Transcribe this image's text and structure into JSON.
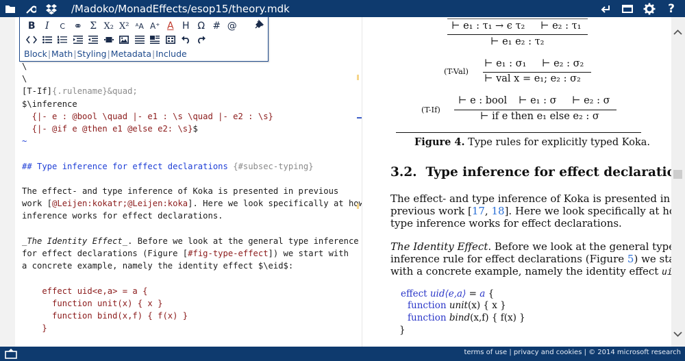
{
  "topbar": {
    "file_path": "/Madoko/MonadEffects/esop15/theory.mdk",
    "icons": [
      "folder-icon",
      "wrench-icon",
      "dropbox-icon",
      "return-icon",
      "window-icon",
      "gear-icon",
      "help-icon"
    ],
    "help_label": "?"
  },
  "toolbar": {
    "row1": [
      "B",
      "I",
      "C",
      "⚭",
      "Σ",
      "X₂",
      "X²",
      "ᴬA",
      "A⁺",
      "A",
      "H",
      "Ω",
      "#",
      "@"
    ],
    "row2_icons": [
      "code-icon",
      "bullet-list-icon",
      "numbered-list-icon",
      "indent-icon",
      "outdent-icon",
      "figure-icon",
      "image-icon",
      "align-icon",
      "caption-icon",
      "table-icon",
      "undo-icon",
      "redo-icon"
    ],
    "tabs": [
      "Block",
      "Math",
      "Styling",
      "Metadata",
      "Include"
    ]
  },
  "editor": {
    "lines": [
      {
        "parts": [
          {
            "t": "\\",
            "c": "dark"
          }
        ]
      },
      {
        "parts": [
          {
            "t": "\\",
            "c": "dark"
          }
        ]
      },
      {
        "parts": [
          {
            "t": "[T-If]",
            "c": "dark"
          },
          {
            "t": "{.rulename}&quad;",
            "c": "gray"
          }
        ]
      },
      {
        "parts": [
          {
            "t": "$\\inference",
            "c": "dark"
          }
        ]
      },
      {
        "parts": [
          {
            "t": "  {|- e : @bool \\quad |- e1 : \\s \\quad |- e2 : \\s}",
            "c": "red"
          }
        ]
      },
      {
        "parts": [
          {
            "t": "  {|- @if e @then e1 @else e2: \\s}",
            "c": "red"
          },
          {
            "t": "$",
            "c": "dark"
          }
        ]
      },
      {
        "parts": [
          {
            "t": "~",
            "c": "blue"
          }
        ]
      },
      {
        "parts": [
          {
            "t": "",
            "c": "dark"
          }
        ]
      },
      {
        "parts": [
          {
            "t": "## Type inference for effect declarations ",
            "c": "blue"
          },
          {
            "t": "{#subsec-typing}",
            "c": "gray"
          }
        ]
      },
      {
        "parts": [
          {
            "t": "",
            "c": "dark"
          }
        ]
      },
      {
        "parts": [
          {
            "t": "The effect- and type inference of Koka is presented in previous",
            "c": "dark"
          }
        ]
      },
      {
        "parts": [
          {
            "t": "work [",
            "c": "dark"
          },
          {
            "t": "@Leijen:kokatr;@Leijen:koka",
            "c": "red"
          },
          {
            "t": "]. Here we look specifically at how",
            "c": "dark"
          }
        ]
      },
      {
        "parts": [
          {
            "t": "inference works for effect declarations.",
            "c": "dark"
          }
        ]
      },
      {
        "parts": [
          {
            "t": "",
            "c": "dark"
          }
        ]
      },
      {
        "parts": [
          {
            "t": "_The Identity Effect_",
            "c": "italic"
          },
          {
            "t": ". Before we look at the general type inference",
            "c": "dark"
          }
        ]
      },
      {
        "parts": [
          {
            "t": "for effect declarations (Figure [",
            "c": "dark"
          },
          {
            "t": "#fig-type-effect",
            "c": "red"
          },
          {
            "t": "]) we start with",
            "c": "dark"
          }
        ]
      },
      {
        "parts": [
          {
            "t": "a concrete example, namely the identity effect $\\eid$:",
            "c": "dark"
          }
        ]
      },
      {
        "parts": [
          {
            "t": "",
            "c": "dark"
          }
        ]
      },
      {
        "parts": [
          {
            "t": "    effect uid<e,a> = a {",
            "c": "red"
          }
        ]
      },
      {
        "parts": [
          {
            "t": "      function unit(x) { x }",
            "c": "red"
          }
        ]
      },
      {
        "parts": [
          {
            "t": "      function bind(x,f) { f(x) }",
            "c": "red"
          }
        ]
      },
      {
        "parts": [
          {
            "t": "    }",
            "c": "red"
          }
        ]
      }
    ]
  },
  "preview": {
    "tapp_premise_left": "⊢ e₁ : τ₁ → ϵ τ₂",
    "tapp_premise_right": "⊢ e₂ : τ₁",
    "tapp_conclusion": "⊢ e₁ e₂ : τ₂",
    "tval_name": "(T-Val)",
    "tval_premise_left": "⊢ e₁ : σ₁",
    "tval_premise_right": "⊢ e₂ : σ₂",
    "tval_conclusion": "⊢ val x = e₁; e₂ : σ₂",
    "tif_name": "(T-If)",
    "tif_premise_1": "⊢ e : bool",
    "tif_premise_2": "⊢ e₁ : σ",
    "tif_premise_3": "⊢ e₂ : σ",
    "tif_conclusion": "⊢ if e then e₁ else e₂ : σ",
    "figure_label": "Figure 4.",
    "figure_caption": " Type rules for explicitly typed Koka.",
    "section_number": "3.2.",
    "section_title": "Type inference for effect declarations",
    "para1_line1": "The effect- and type inference of Koka is presented in",
    "para1_line2_pre": "previous work [",
    "ref1": "17",
    "ref_sep": ", ",
    "ref2": "18",
    "para1_line2_post": "]. Here we look specifically at how",
    "para1_line3": "type inference works for effect declarations.",
    "para2_italic": "The Identity Effect",
    "para2_line1_rest": ". Before we look at the general type",
    "para2_line2_pre": "inference rule for effect declarations (Figure ",
    "fig_ref": "5",
    "para2_line2_post": ") we start",
    "para2_line3_pre": "with a concrete example, namely the identity effect ",
    "uid": "uid",
    "para2_line3_post": ":",
    "code": {
      "l1_kw": "effect ",
      "l1_name": "uid⟨e,a⟩",
      "l1_rest": " = ",
      "l1_a": "a",
      "l1_brace": " {",
      "l2_kw": "function ",
      "l2_name": "unit",
      "l2_rest": "(x) { x }",
      "l3_kw": "function ",
      "l3_name": "bind",
      "l3_rest": "(x,f) { f(x) }",
      "l4": "}"
    }
  },
  "footer": {
    "text": "terms of use | privacy and cookies | © 2014 microsoft research"
  },
  "colors": {
    "bar": "#0e3a6e",
    "link": "#2a6fd6",
    "code_red": "#8b1a1a",
    "code_blue": "#1f3fd6"
  }
}
